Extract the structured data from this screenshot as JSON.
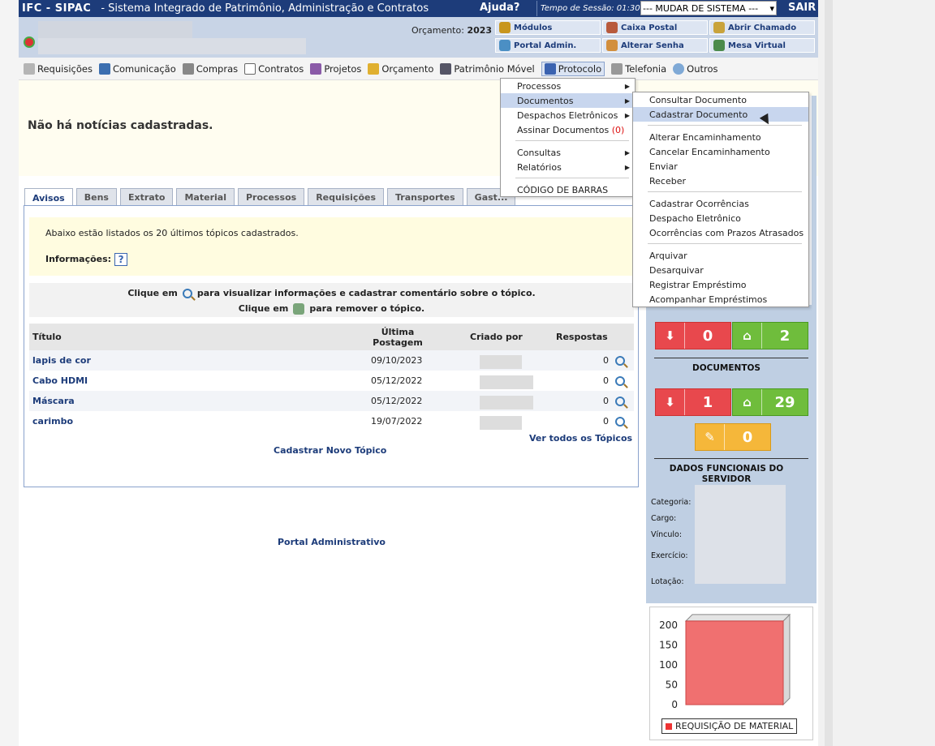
{
  "topbar": {
    "system_name": "IFC - SIPAC",
    "system_full": "- Sistema Integrado de Patrimônio, Administração e Contratos",
    "help": "Ajuda?",
    "session": "Tempo de Sessão: 01:30",
    "change_system": "--- MUDAR DE SISTEMA ---",
    "logout": "SAIR"
  },
  "header": {
    "budget_label": "Orçamento:",
    "budget_year": "2023",
    "quick_links": [
      {
        "label": "Módulos",
        "icon": "modules-icon"
      },
      {
        "label": "Caixa Postal",
        "icon": "mailbox-icon"
      },
      {
        "label": "Abrir Chamado",
        "icon": "ticket-icon"
      },
      {
        "label": "Portal Admin.",
        "icon": "portal-icon"
      },
      {
        "label": "Alterar Senha",
        "icon": "user-key-icon"
      },
      {
        "label": "Mesa Virtual",
        "icon": "desktop-icon"
      }
    ]
  },
  "menu": [
    {
      "label": "Requisições",
      "icon": "requests-icon"
    },
    {
      "label": "Comunicação",
      "icon": "book-icon"
    },
    {
      "label": "Compras",
      "icon": "cart-icon"
    },
    {
      "label": "Contratos",
      "icon": "contract-icon"
    },
    {
      "label": "Projetos",
      "icon": "projects-icon"
    },
    {
      "label": "Orçamento",
      "icon": "coins-icon"
    },
    {
      "label": "Patrimônio Móvel",
      "icon": "monitor-icon"
    },
    {
      "label": "Protocolo",
      "icon": "protocol-icon"
    },
    {
      "label": "Telefonia",
      "icon": "phone-icon"
    },
    {
      "label": "Outros",
      "icon": "search-icon"
    }
  ],
  "protocol_menu": {
    "items": [
      "Processos",
      "Documentos",
      "Despachos Eletrônicos",
      "Assinar Documentos"
    ],
    "sign_count": "(0)",
    "items2": [
      "Consultas",
      "Relatórios"
    ],
    "barcode": "CÓDIGO DE BARRAS"
  },
  "documents_menu": {
    "group1": [
      "Consultar Documento",
      "Cadastrar Documento"
    ],
    "group2": [
      "Alterar Encaminhamento",
      "Cancelar Encaminhamento",
      "Enviar",
      "Receber"
    ],
    "group3": [
      "Cadastrar Ocorrências",
      "Despacho Eletrônico",
      "Ocorrências com Prazos Atrasados"
    ],
    "group4": [
      "Arquivar",
      "Desarquivar",
      "Registrar Empréstimo",
      "Acompanhar Empréstimos"
    ]
  },
  "news": {
    "empty": "Não há notícias cadastradas."
  },
  "tabs": [
    "Avisos",
    "Bens",
    "Extrato",
    "Material",
    "Processos",
    "Requisições",
    "Transportes",
    "Gast..."
  ],
  "notices": {
    "intro": "Abaixo estão listados os 20 últimos tópicos cadastrados.",
    "info_label": "Informações:",
    "info_icon": "?",
    "hint1_a": "Clique em",
    "hint1_b": "para visualizar informações e cadastrar comentário sobre o tópico.",
    "hint2_a": "Clique em",
    "hint2_b": "para remover o tópico.",
    "columns": {
      "title": "Título",
      "last_post": "Última Postagem",
      "created_by": "Criado por",
      "replies": "Respostas"
    },
    "rows": [
      {
        "title": "lapis de cor",
        "date": "09/10/2023",
        "replies": "0"
      },
      {
        "title": "Cabo HDMI",
        "date": "05/12/2022",
        "replies": "0"
      },
      {
        "title": "Máscara",
        "date": "05/12/2022",
        "replies": "0"
      },
      {
        "title": "carimbo",
        "date": "19/07/2022",
        "replies": "0"
      }
    ],
    "see_all": "Ver todos os Tópicos",
    "new_topic": "Cadastrar Novo Tópico"
  },
  "footer": {
    "portal": "Portal Administrativo"
  },
  "right_panel": {
    "processes": {
      "pending": "0",
      "home": "2"
    },
    "documents_title": "DOCUMENTOS",
    "documents": {
      "pending": "1",
      "home": "29",
      "drafts": "0"
    },
    "staff_title": "DADOS FUNCIONAIS DO SERVIDOR",
    "fields": [
      "Categoria:",
      "Cargo:",
      "Vínculo:",
      "Exercício:",
      "Lotação:"
    ]
  },
  "chart_data": {
    "type": "bar",
    "categories": [
      ""
    ],
    "series": [
      {
        "name": "REQUISIÇÃO DE MATERIAL",
        "values": [
          210
        ]
      }
    ],
    "yticks": [
      "200",
      "150",
      "100",
      "50",
      "0"
    ],
    "ylim": [
      0,
      220
    ],
    "color": "#f07070",
    "legend": "bottom"
  }
}
